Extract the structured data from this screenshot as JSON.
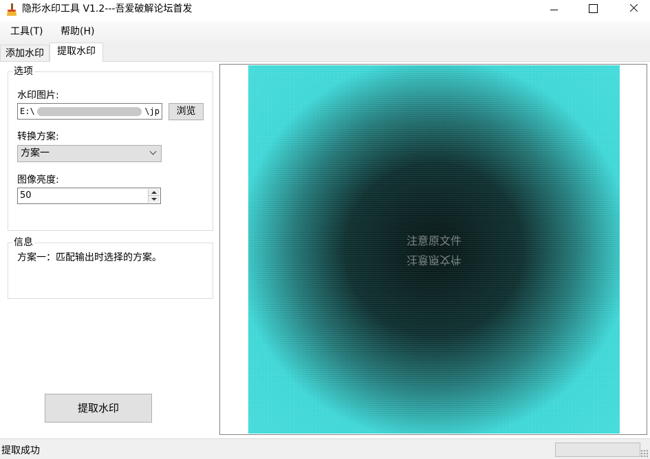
{
  "window": {
    "title": "隐形水印工具 V1.2---吾爱破解论坛首发",
    "icon": "broom-icon"
  },
  "menu": {
    "tools": "工具(T)",
    "help": "帮助(H)"
  },
  "tabs": [
    {
      "label": "添加水印",
      "active": false
    },
    {
      "label": "提取水印",
      "active": true
    }
  ],
  "options": {
    "group_title": "选项",
    "watermark_image_label": "水印图片:",
    "watermark_path_prefix": "E:\\",
    "watermark_path_suffix": "\\jp",
    "browse_label": "浏览",
    "scheme_label": "转换方案:",
    "scheme_value": "方案一",
    "brightness_label": "图像亮度:",
    "brightness_value": "50"
  },
  "info": {
    "group_title": "信息",
    "text": "方案一：匹配输出时选择的方案。"
  },
  "extract_button": "提取水印",
  "preview": {
    "watermark_text": "注意原文件",
    "watermark_text_mirrored": "注意原文件"
  },
  "status": {
    "text": "提取成功",
    "progress": 0
  },
  "colors": {
    "preview_cyan": "#3ee0e0",
    "preview_dark": "#0e2c2c"
  }
}
